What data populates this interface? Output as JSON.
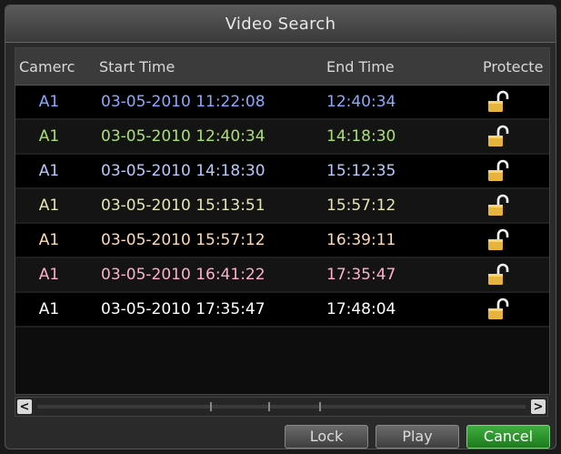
{
  "window": {
    "title": "Video Search"
  },
  "table": {
    "headers": {
      "camera": "Camerc",
      "start_time": "Start Time",
      "end_time": "End Time",
      "protected": "Protecte"
    },
    "rows": [
      {
        "camera": "A1",
        "start": "03-05-2010 11:22:08",
        "end": "12:40:34",
        "lock": "unlocked-padlock-icon"
      },
      {
        "camera": "A1",
        "start": "03-05-2010 12:40:34",
        "end": "14:18:30",
        "lock": "unlocked-padlock-icon"
      },
      {
        "camera": "A1",
        "start": "03-05-2010 14:18:30",
        "end": "15:12:35",
        "lock": "unlocked-padlock-icon"
      },
      {
        "camera": "A1",
        "start": "03-05-2010 15:13:51",
        "end": "15:57:12",
        "lock": "unlocked-padlock-icon"
      },
      {
        "camera": "A1",
        "start": "03-05-2010 15:57:12",
        "end": "16:39:11",
        "lock": "unlocked-padlock-icon"
      },
      {
        "camera": "A1",
        "start": "03-05-2010 16:41:22",
        "end": "17:35:47",
        "lock": "unlocked-padlock-icon"
      },
      {
        "camera": "A1",
        "start": "03-05-2010 17:35:47",
        "end": "17:48:04",
        "lock": "unlocked-padlock-icon"
      }
    ],
    "row_colors": [
      "#8aa8ff",
      "#a8e070",
      "#b8c8ff",
      "#e6e6b0",
      "#ffd9b0",
      "#ffb0c8",
      "#ffffff"
    ]
  },
  "scrollbar": {
    "left_arrow": "<",
    "right_arrow": ">"
  },
  "buttons": {
    "lock": "Lock",
    "play": "Play",
    "cancel": "Cancel"
  },
  "colors": {
    "accent_button": "#2e9a2e",
    "lock_gold": "#e6b43c"
  }
}
